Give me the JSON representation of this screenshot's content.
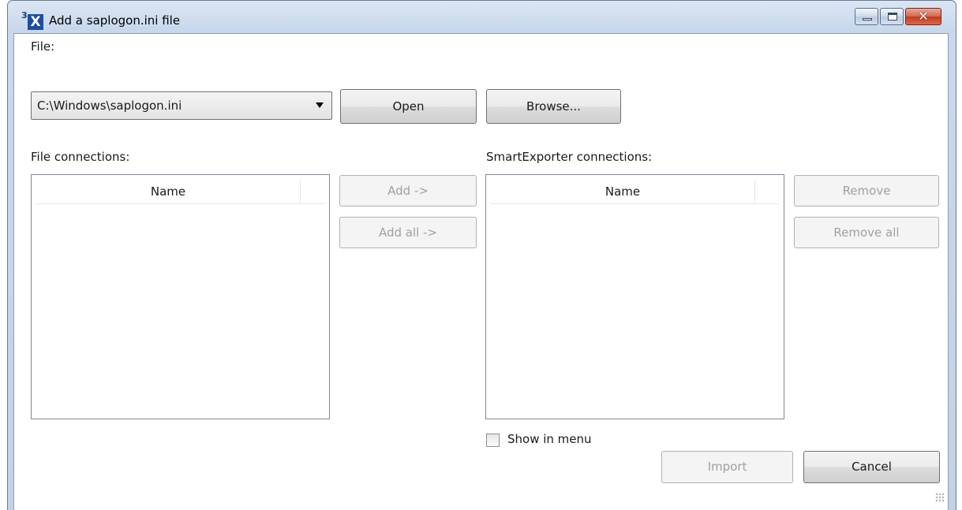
{
  "window": {
    "title": "Add a saplogon.ini file",
    "app_icon_sup": "3",
    "app_icon_letter": "X",
    "close_glyph": "✕"
  },
  "file_section": {
    "label": "File:",
    "selected_file": "C:\\Windows\\saplogon.ini",
    "open_label": "Open",
    "browse_label": "Browse..."
  },
  "file_connections": {
    "label": "File connections:",
    "column_name": "Name",
    "rows": []
  },
  "transfer_buttons": {
    "add_label": "Add ->",
    "add_all_label": "Add all ->"
  },
  "smartexporter_connections": {
    "label": "SmartExporter connections:",
    "column_name": "Name",
    "rows": [],
    "remove_label": "Remove",
    "remove_all_label": "Remove all"
  },
  "options": {
    "show_in_menu_label": "Show in menu",
    "show_in_menu_checked": false
  },
  "footer": {
    "import_label": "Import",
    "cancel_label": "Cancel"
  }
}
